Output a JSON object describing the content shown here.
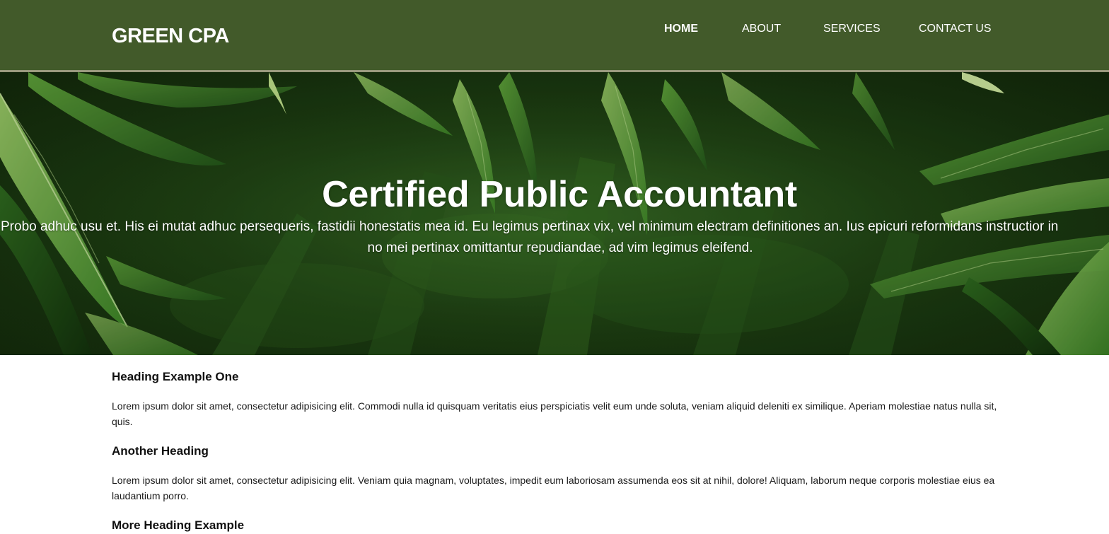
{
  "header": {
    "logo": "GREEN CPA",
    "nav": [
      {
        "label": "HOME",
        "active": true
      },
      {
        "label": "ABOUT",
        "active": false
      },
      {
        "label": "SERVICES",
        "active": false
      },
      {
        "label": "CONTACT US",
        "active": false
      }
    ]
  },
  "hero": {
    "title": "Certified Public Accountant",
    "text_line1": "Probo adhuc usu et. His ei mutat adhuc persequeris, fastidii honestatis mea id. Eu legimus pertinax vix, vel minimum electram definitiones an. Ius epicuri reformidans instructior in",
    "text_line2": "no mei pertinax omittantur repudiandae, ad vim legimus eleifend."
  },
  "content": {
    "sections": [
      {
        "heading": "Heading Example One",
        "body": "Lorem ipsum dolor sit amet, consectetur adipisicing elit. Commodi nulla id quisquam veritatis eius perspiciatis velit eum unde soluta, veniam aliquid deleniti ex similique. Aperiam molestiae natus nulla sit, quis."
      },
      {
        "heading": "Another Heading",
        "body": "Lorem ipsum dolor sit amet, consectetur adipisicing elit. Veniam quia magnam, voluptates, impedit eum laboriosam assumenda eos sit at nihil, dolore! Aliquam, laborum neque corporis molestiae eius ea laudantium porro."
      },
      {
        "heading": "More Heading Example"
      }
    ]
  },
  "colors": {
    "header_bg": "#425a2a",
    "header_border": "#9a9a7e",
    "text_dark": "#111111",
    "hero_text": "#ffffff"
  }
}
